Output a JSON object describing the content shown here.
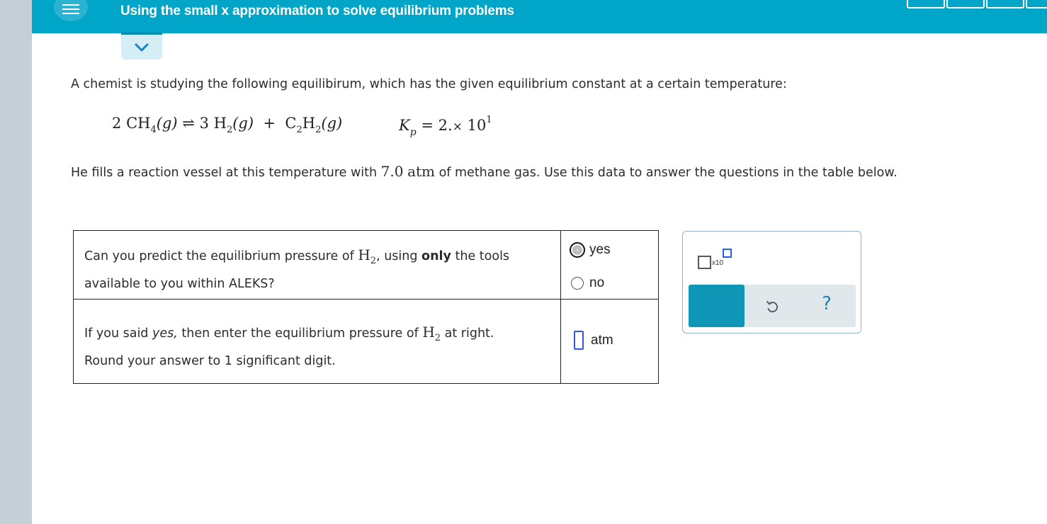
{
  "header": {
    "title": "Using the small x approximation to solve equilibrium problems",
    "menu_icon": "hamburger-menu-icon",
    "collapse_icon": "chevron-down-icon",
    "colors": {
      "topbar": "#00a5c7",
      "rail": "#c4cfd6",
      "accent": "#0f95b5"
    }
  },
  "problem": {
    "intro": "A chemist is studying the following equilibirum, which has the given equilibrium constant at a certain temperature:",
    "reaction": {
      "coef1": "2",
      "sp1": "CH",
      "sp1_sub": "4",
      "phase1": "(g)",
      "arrow": "⇌",
      "coef2": "3",
      "sp2": "H",
      "sp2_sub": "2",
      "phase2": "(g)",
      "plus": "+",
      "sp3a": "C",
      "sp3a_sub": "2",
      "sp3b": "H",
      "sp3b_sub": "2",
      "phase3": "(g)"
    },
    "kp": {
      "symbol": "K",
      "subscript": "p",
      "eq": "=",
      "mantissa": "2.",
      "times": "×",
      "base": "10",
      "exponent": "1"
    },
    "fill_before": "He fills a reaction vessel at this temperature with",
    "amount": "7.0",
    "unit": "atm",
    "fill_after": "of methane gas. Use this data to answer the questions in the table below."
  },
  "table": {
    "q1": {
      "part1": "Can you predict the equilibrium pressure of",
      "species": "H",
      "species_sub": "2",
      "part2": ", using",
      "bold": "only",
      "part3": "the tools",
      "line2": "available to you within ALEKS?"
    },
    "q1_options": [
      {
        "label": "yes",
        "selected": true
      },
      {
        "label": "no",
        "selected": false
      }
    ],
    "q2": {
      "part1": "If you said",
      "italic": "yes,",
      "part2": "then enter the equilibrium pressure of",
      "species": "H",
      "species_sub": "2",
      "part3": "at right.",
      "line2": "Round your answer to 1 significant digit."
    },
    "q2_answer": {
      "value": "",
      "unit": "atm"
    }
  },
  "tools": {
    "sci_label": "x10",
    "sci_icon": "scientific-notation-icon",
    "clear_icon": "clear-x-icon",
    "undo_icon": "undo-icon",
    "help_label": "?"
  }
}
